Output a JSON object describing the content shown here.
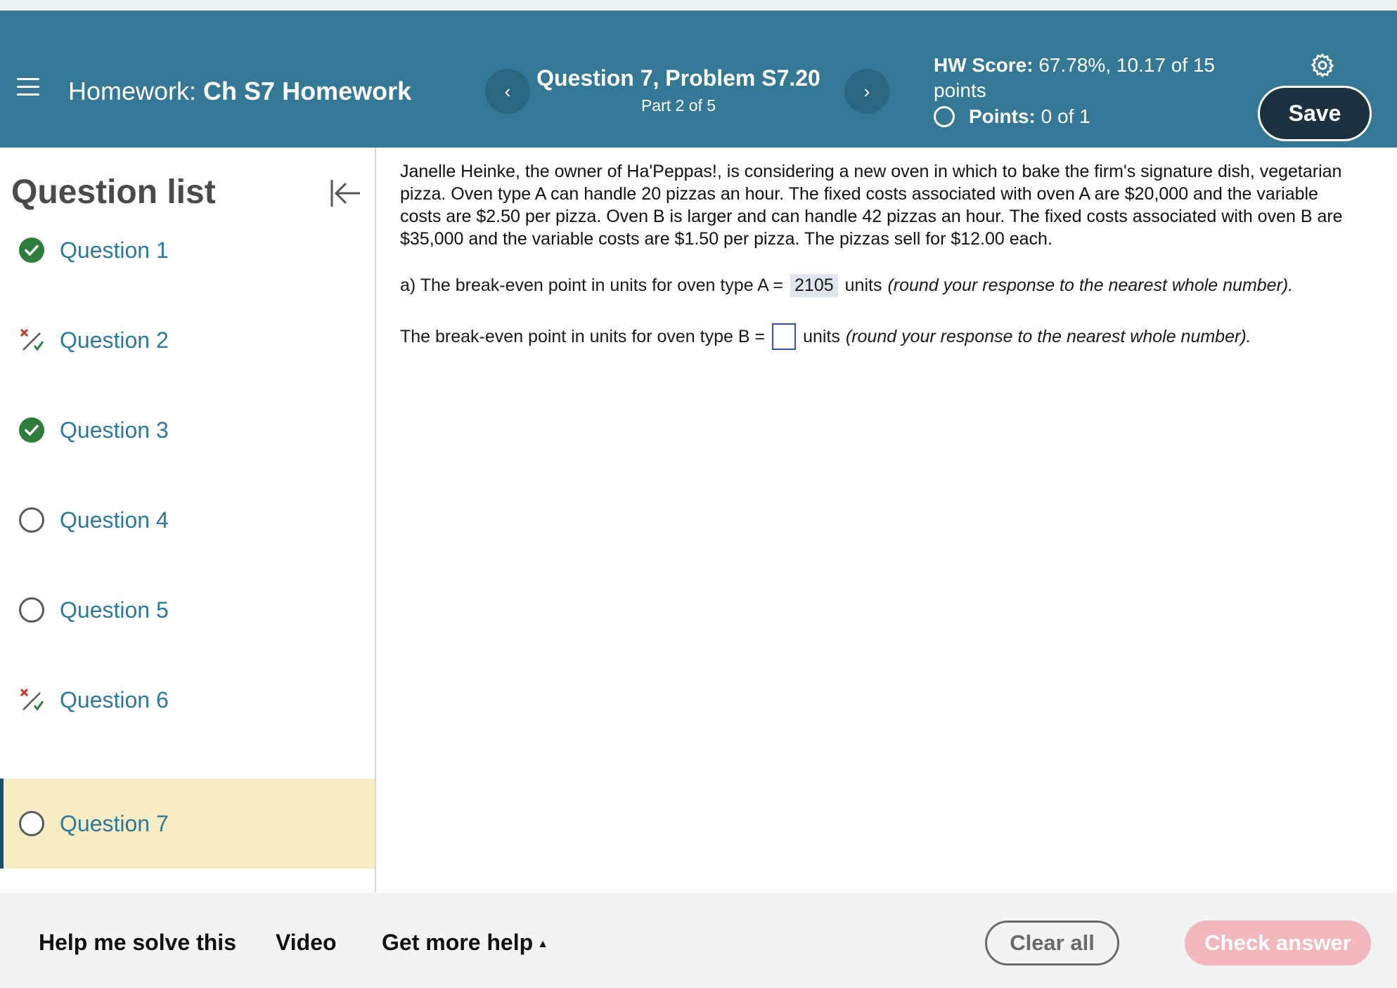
{
  "header": {
    "homework_prefix": "Homework:",
    "homework_name": "Ch S7 Homework",
    "question_title": "Question 7, Problem S7.20",
    "question_part": "Part 2 of 5",
    "hw_score_label": "HW Score:",
    "hw_score_value": "67.78%, 10.17 of 15 points",
    "points_label": "Points:",
    "points_value": "0 of 1",
    "save_label": "Save",
    "prev_glyph": "‹",
    "next_glyph": "›",
    "bg_color": "#357896"
  },
  "sidebar": {
    "title": "Question list",
    "items": [
      {
        "label": "Question 1",
        "status": "correct"
      },
      {
        "label": "Question 2",
        "status": "partial"
      },
      {
        "label": "Question 3",
        "status": "correct"
      },
      {
        "label": "Question 4",
        "status": "unanswered"
      },
      {
        "label": "Question 5",
        "status": "unanswered"
      },
      {
        "label": "Question 6",
        "status": "partial"
      },
      {
        "label": "Question 7",
        "status": "unanswered",
        "active": true
      }
    ]
  },
  "problem": {
    "text": "Janelle Heinke, the owner of Ha'Peppas!, is considering a new oven in which to bake the firm's signature dish, vegetarian pizza. Oven type A can handle 20 pizzas an hour. The fixed costs associated with oven A are $20,000 and the variable costs are $2.50 per pizza. Oven B is larger and can handle 42 pizzas an hour. The fixed costs associated with oven B are  $35,000 and the variable costs are $1.50 per pizza. The pizzas sell for $12.00 each.",
    "part_a_prefix": "a) The break-even point in units for oven type A =",
    "part_a_answer": "2105",
    "part_a_units": "units",
    "part_a_note": "(round your response to the nearest whole number).",
    "part_b_prefix": "The break-even point in units for oven type B =",
    "part_b_value": "",
    "part_b_units": "units",
    "part_b_note": "(round your response to the nearest whole number)."
  },
  "footer": {
    "help_label": "Help me solve this",
    "video_label": "Video",
    "more_help_label": "Get more help",
    "more_help_caret": "▲",
    "clear_label": "Clear all",
    "check_label": "Check answer"
  }
}
